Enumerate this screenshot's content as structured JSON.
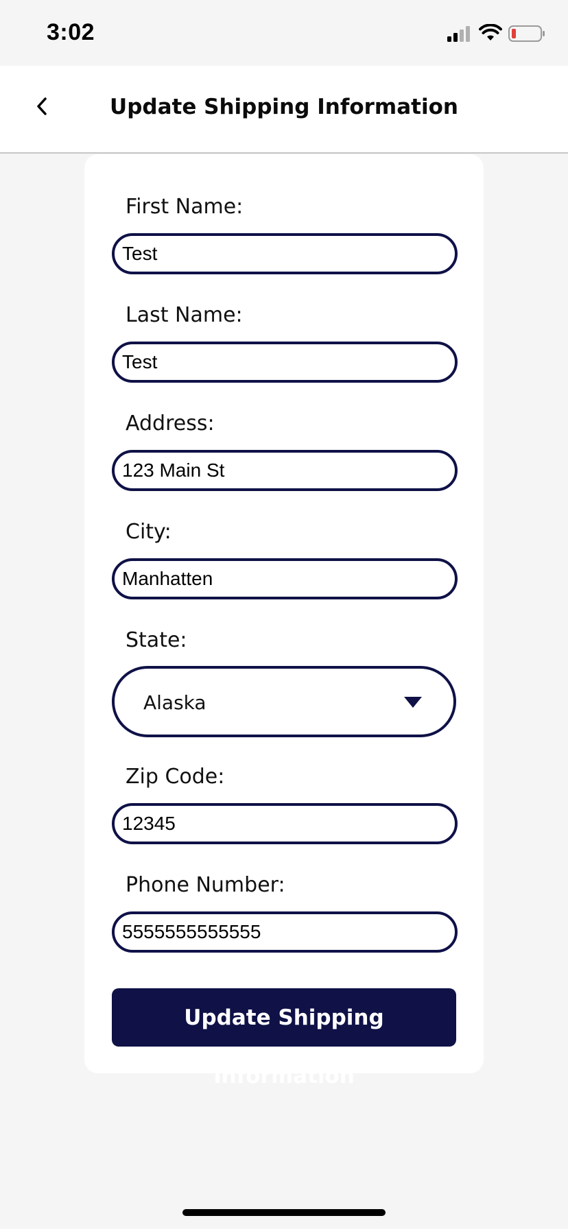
{
  "status_bar": {
    "time": "3:02",
    "signal_icon": "cellular-signal-icon",
    "wifi_icon": "wifi-icon",
    "battery_icon": "battery-low-icon",
    "battery_color": "#e0403a"
  },
  "header": {
    "back_icon": "chevron-left-icon",
    "title": "Update Shipping Information"
  },
  "form": {
    "first_name": {
      "label": "First Name:",
      "value": "Test"
    },
    "last_name": {
      "label": "Last Name:",
      "value": "Test"
    },
    "address": {
      "label": "Address:",
      "value": "123 Main St"
    },
    "city": {
      "label": "City:",
      "value": "Manhatten"
    },
    "state": {
      "label": "State:",
      "selected": "Alaska",
      "icon": "caret-down-icon"
    },
    "zip": {
      "label": "Zip Code:",
      "value": "12345"
    },
    "phone": {
      "label": "Phone Number:",
      "value": "5555555555555"
    },
    "submit_label": "Update Shipping Information"
  },
  "colors": {
    "accent": "#0f1147",
    "background": "#f5f5f5",
    "card": "#ffffff"
  }
}
